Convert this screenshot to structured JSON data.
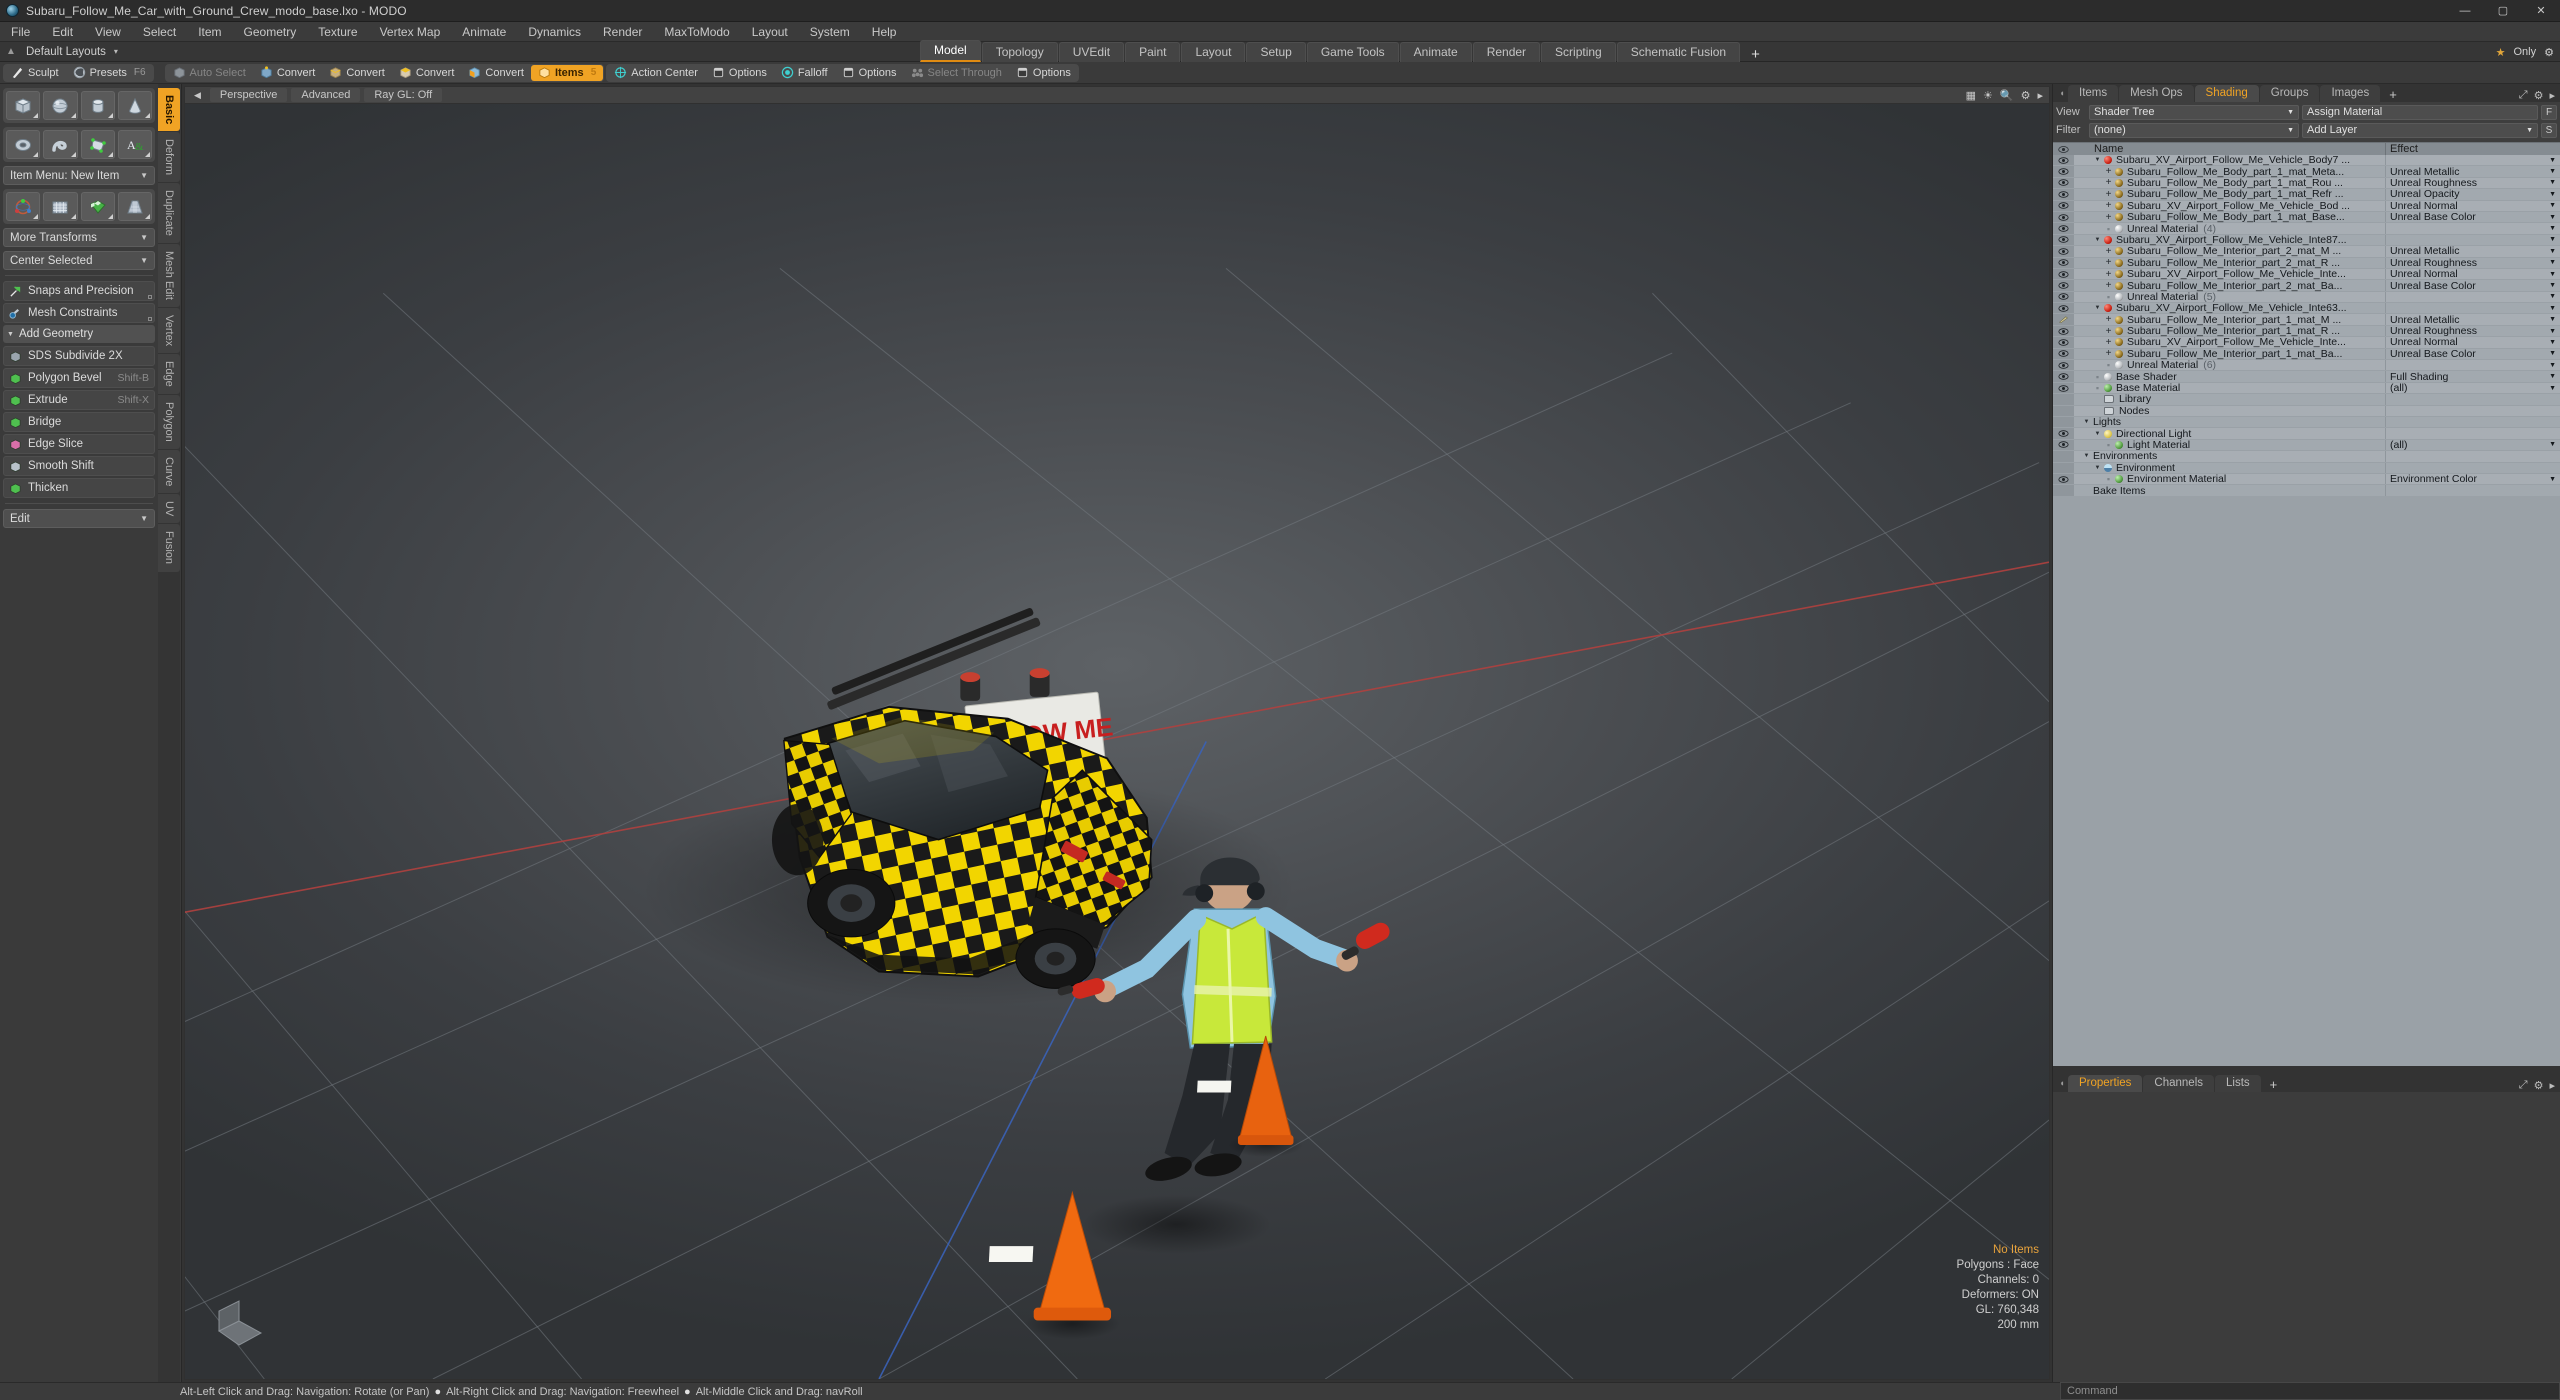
{
  "window": {
    "title": "Subaru_Follow_Me_Car_with_Ground_Crew_modo_base.lxo - MODO",
    "minimize": "—",
    "maximize": "▢",
    "close": "✕"
  },
  "menubar": {
    "items": [
      "File",
      "Edit",
      "View",
      "Select",
      "Item",
      "Geometry",
      "Texture",
      "Vertex Map",
      "Animate",
      "Dynamics",
      "Render",
      "MaxToModo",
      "Layout",
      "System",
      "Help"
    ]
  },
  "layout_row": {
    "preset": "Default Layouts",
    "caret": "▾",
    "tabs": [
      {
        "label": "Model",
        "active": true
      },
      {
        "label": "Topology",
        "active": false
      },
      {
        "label": "UVEdit",
        "active": false
      },
      {
        "label": "Paint",
        "active": false
      },
      {
        "label": "Layout",
        "active": false
      },
      {
        "label": "Setup",
        "active": false
      },
      {
        "label": "Game Tools",
        "active": false
      },
      {
        "label": "Animate",
        "active": false
      },
      {
        "label": "Render",
        "active": false
      },
      {
        "label": "Scripting",
        "active": false
      },
      {
        "label": "Schematic Fusion",
        "active": false
      }
    ],
    "add_tab": "+",
    "only_label": "Only",
    "star": "★"
  },
  "toolbar": {
    "left_group": [
      {
        "label": "Sculpt",
        "icon": "brush-icon",
        "state": "normal"
      },
      {
        "label": "Presets",
        "icon": "sphere-icon",
        "state": "normal",
        "shortcut": "F6"
      }
    ],
    "mode_group": [
      {
        "label": "Auto Select",
        "icon": "cube-gray-icon",
        "state": "dim"
      },
      {
        "label": "Convert",
        "icon": "cube-vertex-icon",
        "state": "normal"
      },
      {
        "label": "Convert",
        "icon": "cube-edge-icon",
        "state": "normal"
      },
      {
        "label": "Convert",
        "icon": "cube-poly-icon",
        "state": "normal"
      },
      {
        "label": "Convert",
        "icon": "cube-material-icon",
        "state": "normal"
      },
      {
        "label": "Items",
        "icon": "cube-orange-icon",
        "state": "active",
        "badge": "5"
      }
    ],
    "action_group": [
      {
        "label": "Action Center",
        "icon": "crosshair-icon",
        "state": "normal"
      },
      {
        "label": "Options",
        "icon": "panel-icon",
        "state": "normal"
      },
      {
        "label": "Falloff",
        "icon": "target-icon",
        "state": "normal"
      },
      {
        "label": "Options",
        "icon": "panel-icon",
        "state": "normal"
      },
      {
        "label": "Select Through",
        "icon": "selectthrough-icon",
        "state": "dim"
      },
      {
        "label": "Options",
        "icon": "panel-icon",
        "state": "normal"
      }
    ]
  },
  "left_panel": {
    "vertical_tabs": [
      {
        "label": "Basic",
        "active": true
      },
      {
        "label": "Deform",
        "active": false
      },
      {
        "label": "Duplicate",
        "active": false
      },
      {
        "label": "Mesh Edit",
        "active": false
      },
      {
        "label": "Vertex",
        "active": false
      },
      {
        "label": "Edge",
        "active": false
      },
      {
        "label": "Polygon",
        "active": false
      },
      {
        "label": "Curve",
        "active": false
      },
      {
        "label": "UV",
        "active": false
      },
      {
        "label": "Fusion",
        "active": false
      }
    ],
    "primitives": [
      "cube-icon",
      "sphere-icon",
      "cylinder-icon",
      "cone-icon"
    ],
    "primitives2": [
      "torus-icon",
      "tube-icon",
      "polygon-tool-icon",
      "text-tool-icon"
    ],
    "item_menu": "Item Menu: New Item",
    "transforms_icons": [
      "transform-gizmo-icon",
      "grid-tool-icon",
      "checker-tool-icon",
      "taper-tool-icon"
    ],
    "more_transforms": "More Transforms",
    "center_selected": "Center Selected",
    "snaps": "Snaps and Precision",
    "mesh_constraints": "Mesh Constraints",
    "add_geometry_header": "Add Geometry",
    "tools": [
      {
        "label": "SDS Subdivide 2X",
        "shortcut": "",
        "icon": "sds-icon"
      },
      {
        "label": "Polygon Bevel",
        "shortcut": "Shift-B",
        "icon": "bevel-icon"
      },
      {
        "label": "Extrude",
        "shortcut": "Shift-X",
        "icon": "extrude-icon"
      },
      {
        "label": "Bridge",
        "shortcut": "",
        "icon": "bridge-icon"
      },
      {
        "label": "Edge Slice",
        "shortcut": "",
        "icon": "edgeslice-icon"
      },
      {
        "label": "Smooth Shift",
        "shortcut": "",
        "icon": "smoothshift-icon"
      },
      {
        "label": "Thicken",
        "shortcut": "",
        "icon": "thicken-icon"
      }
    ],
    "edit_dropdown": "Edit"
  },
  "viewport": {
    "header": {
      "perspective": "Perspective",
      "advanced": "Advanced",
      "raygl": "Ray GL: Off",
      "left_arrow": "◀"
    },
    "stats": {
      "no_items": "No Items",
      "polygons": "Polygons : Face",
      "channels": "Channels: 0",
      "deformers": "Deformers: ON",
      "gl": "GL: 760,348",
      "scale": "200 mm"
    },
    "sign_text": "FOLLOW ME"
  },
  "right_panel": {
    "tabs": [
      {
        "label": "Items",
        "active": false
      },
      {
        "label": "Mesh Ops",
        "active": false
      },
      {
        "label": "Shading",
        "active": true
      },
      {
        "label": "Groups",
        "active": false
      },
      {
        "label": "Images",
        "active": false
      }
    ],
    "add_tab": "+",
    "controls": {
      "view_label": "View",
      "view_value": "Shader Tree",
      "assign_material": "Assign Material",
      "f_button": "F",
      "filter_label": "Filter",
      "filter_value": "(none)",
      "add_layer": "Add Layer",
      "s_button": "S"
    },
    "tree_headers": {
      "eye": "",
      "name": "Name",
      "effect": "Effect"
    },
    "tree_rows": [
      {
        "indent": 1,
        "toggle": "tri",
        "icon": "sp-red",
        "name": "Subaru_XV_Airport_Follow_Me_Vehicle_Body7 ...",
        "effect": "",
        "caret": true,
        "eye": "eye"
      },
      {
        "indent": 2,
        "toggle": "plus",
        "icon": "sp-gold",
        "name": "Subaru_Follow_Me_Body_part_1_mat_Meta...",
        "effect": "Unreal Metallic",
        "caret": true,
        "eye": "eye"
      },
      {
        "indent": 2,
        "toggle": "plus",
        "icon": "sp-gold",
        "name": "Subaru_Follow_Me_Body_part_1_mat_Rou ...",
        "effect": "Unreal Roughness",
        "caret": true,
        "eye": "eye"
      },
      {
        "indent": 2,
        "toggle": "plus",
        "icon": "sp-gold",
        "name": "Subaru_Follow_Me_Body_part_1_mat_Refr ...",
        "effect": "Unreal Opacity",
        "caret": true,
        "eye": "eye"
      },
      {
        "indent": 2,
        "toggle": "plus",
        "icon": "sp-gold",
        "name": "Subaru_XV_Airport_Follow_Me_Vehicle_Bod ...",
        "effect": "Unreal Normal",
        "caret": true,
        "eye": "eye"
      },
      {
        "indent": 2,
        "toggle": "plus",
        "icon": "sp-gold",
        "name": "Subaru_Follow_Me_Body_part_1_mat_Base...",
        "effect": "Unreal Base Color",
        "caret": true,
        "eye": "eye"
      },
      {
        "indent": 2,
        "toggle": "dash",
        "icon": "sp-white",
        "name": "Unreal Material",
        "count": "(4)",
        "effect": "",
        "caret": true,
        "eye": "eye"
      },
      {
        "indent": 1,
        "toggle": "tri",
        "icon": "sp-red",
        "name": "Subaru_XV_Airport_Follow_Me_Vehicle_Inte87...",
        "effect": "",
        "caret": true,
        "eye": "eye"
      },
      {
        "indent": 2,
        "toggle": "plus",
        "icon": "sp-gold",
        "name": "Subaru_Follow_Me_Interior_part_2_mat_M ...",
        "effect": "Unreal Metallic",
        "caret": true,
        "eye": "eye"
      },
      {
        "indent": 2,
        "toggle": "plus",
        "icon": "sp-gold",
        "name": "Subaru_Follow_Me_Interior_part_2_mat_R ...",
        "effect": "Unreal Roughness",
        "caret": true,
        "eye": "eye"
      },
      {
        "indent": 2,
        "toggle": "plus",
        "icon": "sp-gold",
        "name": "Subaru_XV_Airport_Follow_Me_Vehicle_Inte...",
        "effect": "Unreal Normal",
        "caret": true,
        "eye": "eye"
      },
      {
        "indent": 2,
        "toggle": "plus",
        "icon": "sp-gold",
        "name": "Subaru_Follow_Me_Interior_part_2_mat_Ba...",
        "effect": "Unreal Base Color",
        "caret": true,
        "eye": "eye"
      },
      {
        "indent": 2,
        "toggle": "dash",
        "icon": "sp-white",
        "name": "Unreal Material",
        "count": "(5)",
        "effect": "",
        "caret": true,
        "eye": "eye"
      },
      {
        "indent": 1,
        "toggle": "tri",
        "icon": "sp-red",
        "name": "Subaru_XV_Airport_Follow_Me_Vehicle_Inte63...",
        "effect": "",
        "caret": true,
        "eye": "eye"
      },
      {
        "indent": 2,
        "toggle": "plus",
        "icon": "sp-gold",
        "name": "Subaru_Follow_Me_Interior_part_1_mat_M ...",
        "effect": "Unreal Metallic",
        "caret": true,
        "eye": "brush"
      },
      {
        "indent": 2,
        "toggle": "plus",
        "icon": "sp-gold",
        "name": "Subaru_Follow_Me_Interior_part_1_mat_R ...",
        "effect": "Unreal Roughness",
        "caret": true,
        "eye": "eye"
      },
      {
        "indent": 2,
        "toggle": "plus",
        "icon": "sp-gold",
        "name": "Subaru_XV_Airport_Follow_Me_Vehicle_Inte...",
        "effect": "Unreal Normal",
        "caret": true,
        "eye": "eye"
      },
      {
        "indent": 2,
        "toggle": "plus",
        "icon": "sp-gold",
        "name": "Subaru_Follow_Me_Interior_part_1_mat_Ba...",
        "effect": "Unreal Base Color",
        "caret": true,
        "eye": "eye"
      },
      {
        "indent": 2,
        "toggle": "dash",
        "icon": "sp-white",
        "name": "Unreal Material",
        "count": "(6)",
        "effect": "",
        "caret": true,
        "eye": "eye"
      },
      {
        "indent": 1,
        "toggle": "dash",
        "icon": "sp-white",
        "name": "Base Shader",
        "effect": "Full Shading",
        "caret": true,
        "eye": "eye"
      },
      {
        "indent": 1,
        "toggle": "dash",
        "icon": "sp-green",
        "name": "Base Material",
        "effect": "(all)",
        "caret": true,
        "eye": "eye"
      },
      {
        "indent": 1,
        "toggle": "none",
        "icon": "folder",
        "name": "Library",
        "effect": "",
        "caret": false,
        "eye": "none"
      },
      {
        "indent": 1,
        "toggle": "none",
        "icon": "folder",
        "name": "Nodes",
        "effect": "",
        "caret": false,
        "eye": "none"
      },
      {
        "indent": 0,
        "toggle": "tri",
        "icon": "none",
        "name": "Lights",
        "effect": "",
        "caret": false,
        "eye": "none"
      },
      {
        "indent": 1,
        "toggle": "tri",
        "icon": "sp-light",
        "name": "Directional Light",
        "effect": "",
        "caret": false,
        "eye": "eye"
      },
      {
        "indent": 2,
        "toggle": "dash",
        "icon": "sp-green",
        "name": "Light Material",
        "effect": "(all)",
        "caret": true,
        "eye": "eye"
      },
      {
        "indent": 0,
        "toggle": "tri",
        "icon": "none",
        "name": "Environments",
        "effect": "",
        "caret": false,
        "eye": "none"
      },
      {
        "indent": 1,
        "toggle": "tri",
        "icon": "sp-blue",
        "name": "Environment",
        "effect": "",
        "caret": false,
        "eye": "none"
      },
      {
        "indent": 2,
        "toggle": "dash",
        "icon": "sp-green",
        "name": "Environment Material",
        "effect": "Environment Color",
        "caret": true,
        "eye": "eye"
      },
      {
        "indent": 0,
        "toggle": "none",
        "icon": "none",
        "name": "Bake Items",
        "effect": "",
        "caret": false,
        "eye": "none"
      }
    ]
  },
  "properties_panel": {
    "tabs": [
      {
        "label": "Properties",
        "active": true
      },
      {
        "label": "Channels",
        "active": false
      },
      {
        "label": "Lists",
        "active": false
      }
    ],
    "add_tab": "+"
  },
  "statusbar": {
    "hints": [
      "Alt-Left Click and Drag: Navigation: Rotate (or Pan)",
      "Alt-Right Click and Drag: Navigation: Freewheel",
      "Alt-Middle Click and Drag: navRoll"
    ],
    "bullet": "●",
    "command_placeholder": "Command"
  },
  "colors": {
    "accent": "#f0a324",
    "panel_bg": "#3a3a3a",
    "tree_bg": "#a5acb2",
    "axis_x": "#b03a3a",
    "axis_z": "#3a5ab0"
  }
}
